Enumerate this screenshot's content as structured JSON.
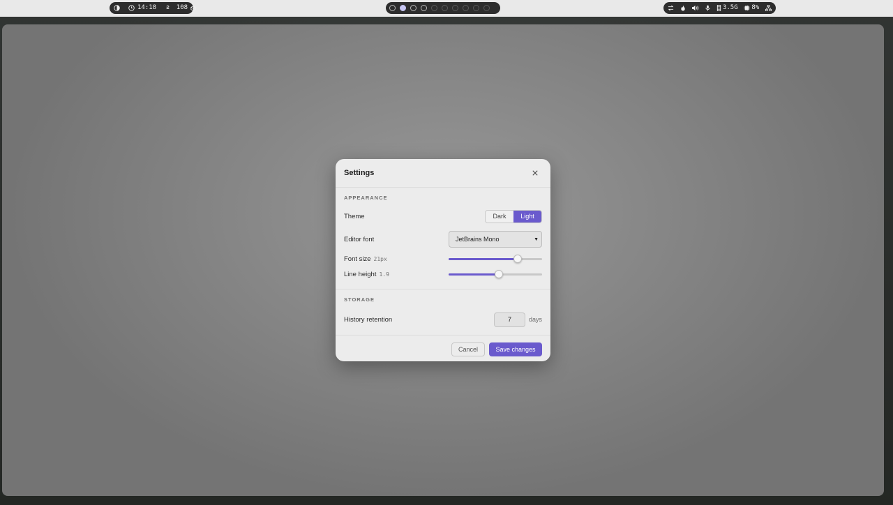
{
  "statusbar": {
    "left": {
      "launcher_icon": "half-moon-icon",
      "clock_icon": "clock-icon",
      "time": "14:18",
      "app_glyph": "ꙅ",
      "count": "108",
      "count_icon": "package-icon"
    },
    "workspaces": [
      {
        "state": "occupied"
      },
      {
        "state": "active"
      },
      {
        "state": "occupied"
      },
      {
        "state": "occupied"
      },
      {
        "state": "empty"
      },
      {
        "state": "empty"
      },
      {
        "state": "empty"
      },
      {
        "state": "empty"
      },
      {
        "state": "empty"
      },
      {
        "state": "empty"
      }
    ],
    "right": {
      "network_icon": "swap-arrows-icon",
      "brightness_icon": "flame-icon",
      "volume_icon": "speaker-icon",
      "mic_icon": "microphone-icon",
      "memory_icon": "memory-icon",
      "memory": "3.5G",
      "cpu_icon": "cpu-icon",
      "cpu": "8%",
      "tray_icon": "network-tree-icon"
    }
  },
  "dialog": {
    "title": "Settings",
    "appearance": {
      "section_title": "APPEARANCE",
      "theme_label": "Theme",
      "theme_options": [
        "Dark",
        "Light"
      ],
      "theme_selected": "Light",
      "font_label": "Editor font",
      "font_value": "JetBrains Mono",
      "font_size_label": "Font size",
      "font_size_value": "21px",
      "font_size_fraction": 0.74,
      "line_height_label": "Line height",
      "line_height_value": "1.9",
      "line_height_fraction": 0.54
    },
    "storage": {
      "section_title": "STORAGE",
      "retention_label": "History retention",
      "retention_value": "7",
      "retention_unit": "days"
    },
    "buttons": {
      "cancel": "Cancel",
      "save": "Save changes"
    }
  },
  "colors": {
    "accent": "#6a5acd",
    "active_workspace": "#c7c6f3"
  }
}
